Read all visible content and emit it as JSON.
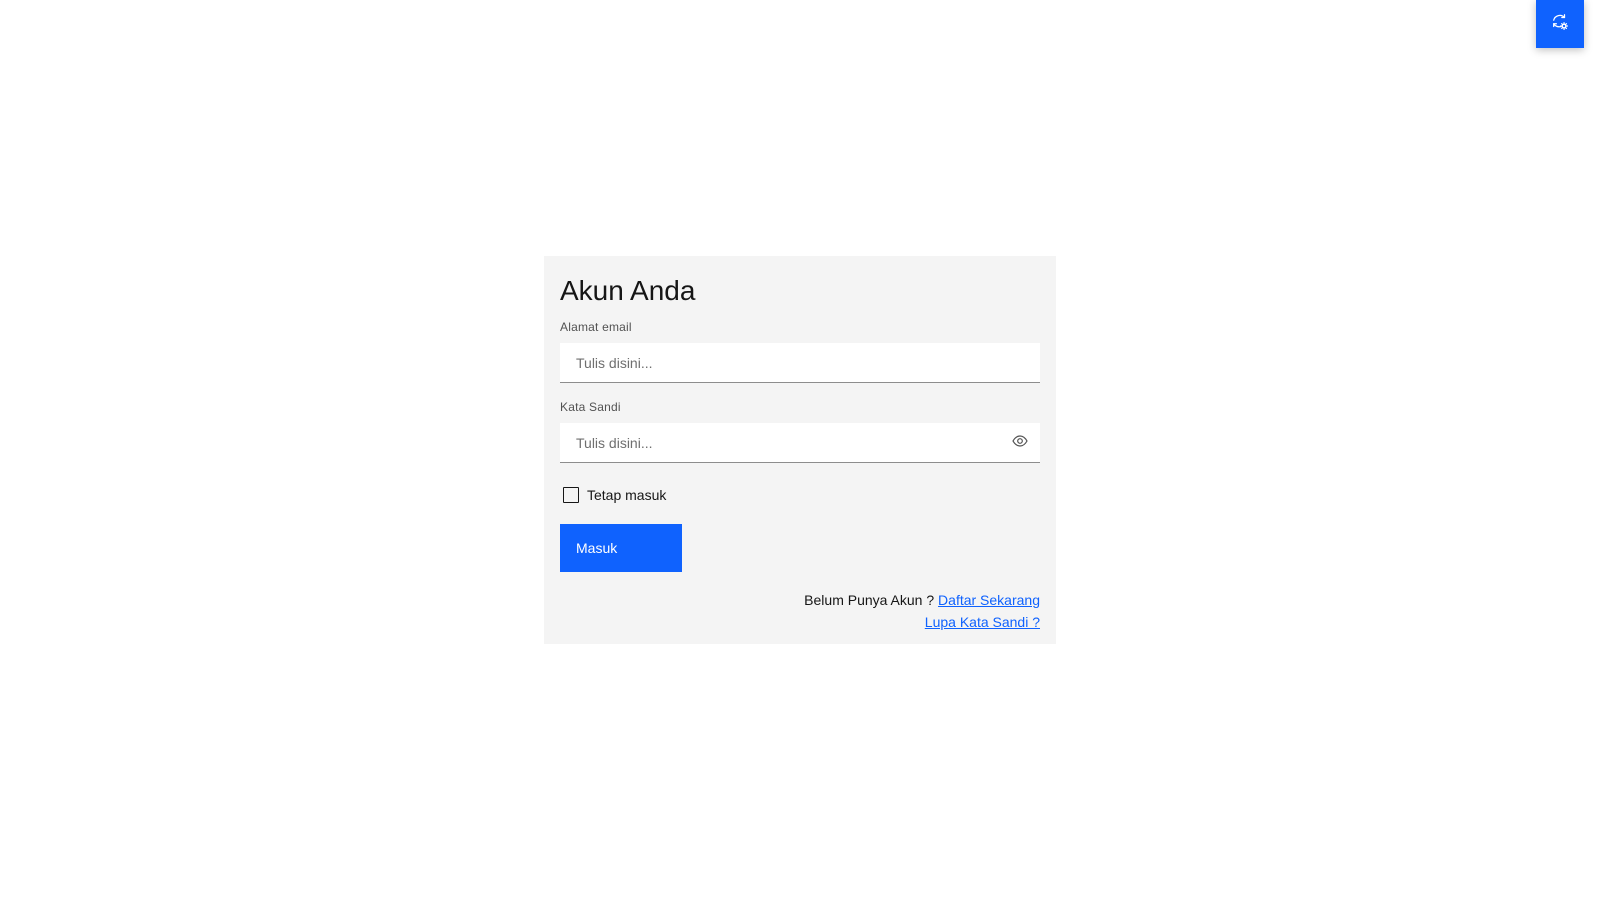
{
  "top_action": {
    "icon": "settings-sync-icon",
    "color": "#0f62fe"
  },
  "login": {
    "title": "Akun Anda",
    "email_label": "Alamat email",
    "email_placeholder": "Tulis disini...",
    "email_value": "",
    "password_label": "Kata Sandi",
    "password_placeholder": "Tulis disini...",
    "password_value": "",
    "show_password_icon": "eye-icon",
    "remember_label": "Tetap masuk",
    "remember_checked": false,
    "submit_label": "Masuk",
    "no_account_text": "Belum Punya Akun ?",
    "register_link": "Daftar Sekarang",
    "forgot_link": "Lupa Kata Sandi ?"
  },
  "colors": {
    "primary": "#0f62fe",
    "card_background": "#f4f4f4",
    "text": "#161616"
  }
}
